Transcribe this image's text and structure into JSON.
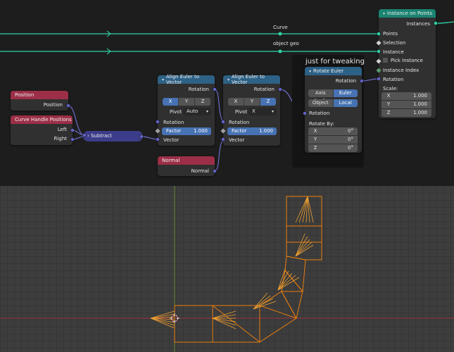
{
  "reroutes": {
    "curve": "Curve",
    "object_geo": "object geo"
  },
  "frame": {
    "label": "just for tweaking"
  },
  "nodes": {
    "position": {
      "title": "Position",
      "output": "Position"
    },
    "curve_handle_positions": {
      "title": "Curve Handle Positions",
      "outputs": [
        "Left",
        "Right"
      ]
    },
    "subtract": {
      "title": "Subtract"
    },
    "align1": {
      "title": "Align Euler to Vector",
      "output": "Rotation",
      "axis": [
        "X",
        "Y",
        "Z"
      ],
      "axis_selected": "X",
      "pivot_label": "Pivot",
      "pivot_value": "Auto",
      "inputs": [
        "Rotation",
        "Vector"
      ],
      "factor_label": "Factor",
      "factor_value": "1.000"
    },
    "align2": {
      "title": "Align Euler to Vector",
      "output": "Rotation",
      "axis": [
        "X",
        "Y",
        "Z"
      ],
      "axis_selected": "Z",
      "pivot_label": "Pivot",
      "pivot_value": "X",
      "inputs": [
        "Rotation",
        "Vector"
      ],
      "factor_label": "Factor",
      "factor_value": "1.000"
    },
    "normal": {
      "title": "Normal",
      "output": "Normal"
    },
    "rotate_euler": {
      "title": "Rotate Euler",
      "output": "Rotation",
      "mode": [
        "Axis Angle",
        "Euler"
      ],
      "mode_selected": "Euler",
      "space": [
        "Object",
        "Local"
      ],
      "space_selected": "Local",
      "input": "Rotation",
      "rotate_by_label": "Rotate By:",
      "rotate_by": [
        {
          "axis": "X",
          "value": "0°"
        },
        {
          "axis": "Y",
          "value": "0°"
        },
        {
          "axis": "Z",
          "value": "0°"
        }
      ]
    },
    "instance_on_points": {
      "title": "Instance on Points",
      "output": "Instances",
      "inputs": [
        "Points",
        "Selection",
        "Instance",
        "Pick Instance",
        "Instance Index",
        "Rotation"
      ],
      "scale_label": "Scale:",
      "scale": [
        {
          "axis": "X",
          "value": "1.000"
        },
        {
          "axis": "Y",
          "value": "1.000"
        },
        {
          "axis": "Z",
          "value": "1.000"
        }
      ]
    }
  },
  "colors": {
    "geometry_socket": "#00d6a3",
    "vector_socket": "#6363c7",
    "rotation_socket": "#6363c7",
    "field_socket": "#cccccc",
    "mesh_wire": "#e87d0d",
    "x_axis": "#ff3352",
    "y_axis": "#8bdc00"
  }
}
